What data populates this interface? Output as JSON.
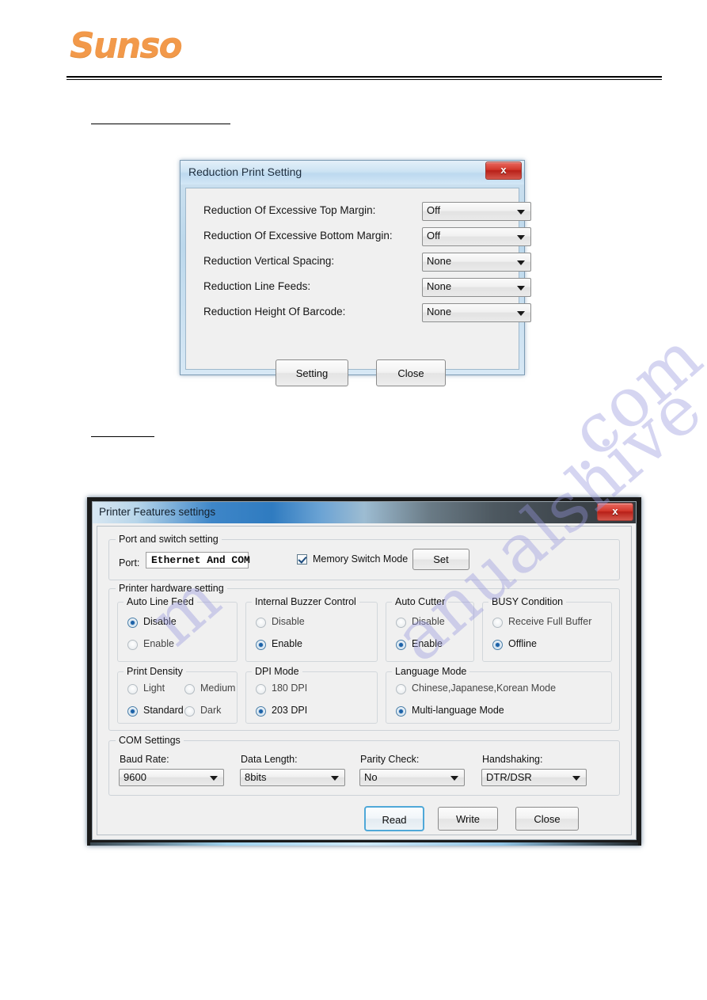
{
  "page": {
    "brand": "Sunso",
    "heading_1": "",
    "heading_2": "",
    "watermark_part_a": "m",
    "watermark_part_b": "anualshive",
    "watermark_part_c": ".com",
    "brand_color": "#F2994A"
  },
  "reduction_dialog": {
    "title": "Reduction Print Setting",
    "close_icon": "x",
    "rows": [
      {
        "label": "Reduction Of Excessive Top Margin:",
        "value": "Off"
      },
      {
        "label": "Reduction Of Excessive Bottom Margin:",
        "value": "Off"
      },
      {
        "label": "Reduction Vertical Spacing:",
        "value": "None"
      },
      {
        "label": "Reduction Line Feeds:",
        "value": "None"
      },
      {
        "label": "Reduction Height Of Barcode:",
        "value": "None"
      }
    ],
    "setting_button": "Setting",
    "close_button": "Close"
  },
  "features_dialog": {
    "title": "Printer Features settings",
    "close_icon": "x",
    "port_group": {
      "title": "Port and switch setting",
      "port_label": "Port:",
      "port_value": "Ethernet And COM",
      "memory_switch_label": "Memory Switch Mode",
      "memory_switch_checked": true,
      "set_button": "Set"
    },
    "hardware_group": {
      "title": "Printer hardware setting",
      "subgroups": [
        {
          "title": "Auto Line Feed",
          "options": [
            {
              "label": "Disable",
              "selected": true
            },
            {
              "label": "Enable",
              "selected": false
            }
          ]
        },
        {
          "title": "Internal Buzzer Control",
          "options": [
            {
              "label": "Disable",
              "selected": false
            },
            {
              "label": "Enable",
              "selected": true
            }
          ]
        },
        {
          "title": "Auto Cutter",
          "options": [
            {
              "label": "Disable",
              "selected": false
            },
            {
              "label": "Enable",
              "selected": true
            }
          ]
        },
        {
          "title": "BUSY Condition",
          "options": [
            {
              "label": "Receive Full Buffer",
              "selected": false
            },
            {
              "label": "Offline",
              "selected": true
            }
          ]
        },
        {
          "title": "Print Density",
          "options": [
            {
              "label": "Light",
              "selected": false
            },
            {
              "label": "Medium",
              "selected": false
            },
            {
              "label": "Standard",
              "selected": true
            },
            {
              "label": "Dark",
              "selected": false
            }
          ]
        },
        {
          "title": "DPI Mode",
          "options": [
            {
              "label": "180 DPI",
              "selected": false
            },
            {
              "label": "203 DPI",
              "selected": true
            }
          ]
        },
        {
          "title": "Language Mode",
          "options": [
            {
              "label": "Chinese,Japanese,Korean Mode",
              "selected": false
            },
            {
              "label": "Multi-language Mode",
              "selected": true
            }
          ]
        }
      ]
    },
    "com_group": {
      "title": "COM Settings",
      "fields": [
        {
          "label": "Baud Rate:",
          "value": "9600"
        },
        {
          "label": "Data Length:",
          "value": "8bits"
        },
        {
          "label": "Parity Check:",
          "value": "No"
        },
        {
          "label": "Handshaking:",
          "value": "DTR/DSR"
        }
      ]
    },
    "read_button": "Read",
    "write_button": "Write",
    "close_button": "Close"
  }
}
